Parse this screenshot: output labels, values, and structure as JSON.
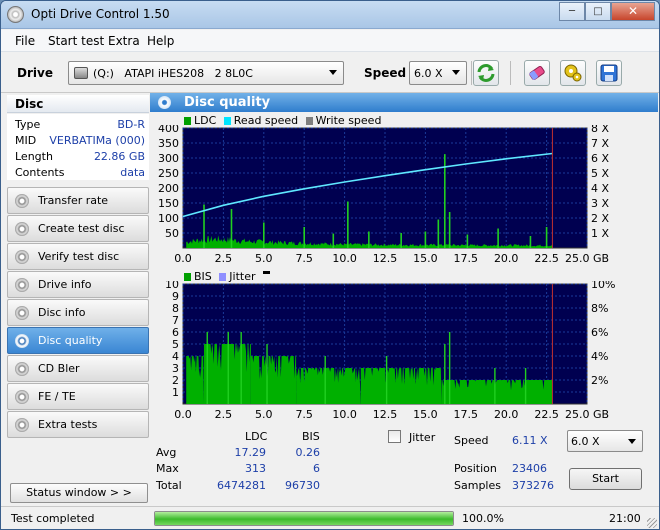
{
  "app": {
    "title": "Opti Drive Control 1.50"
  },
  "window_buttons": {
    "minimize": "─",
    "maximize": "□",
    "close": "✕"
  },
  "menu": [
    "File",
    "Start test",
    "Extra",
    "Help"
  ],
  "toolbar": {
    "drive_label": "Drive",
    "drive_value": "(Q:)   ATAPI iHES208   2 8L0C",
    "speed_label": "Speed",
    "speed_value": "6.0 X",
    "buttons": [
      "refresh-icon",
      "eraser-icon",
      "settings-icon",
      "save-icon"
    ]
  },
  "disc": {
    "header": "Disc",
    "info": [
      {
        "key": "Type",
        "value": "BD-R"
      },
      {
        "key": "MID",
        "value": "VERBATIMa (000)"
      },
      {
        "key": "Length",
        "value": "22.86 GB"
      },
      {
        "key": "Contents",
        "value": "data"
      }
    ]
  },
  "nav": [
    {
      "label": "Transfer rate",
      "active": false
    },
    {
      "label": "Create test disc",
      "active": false
    },
    {
      "label": "Verify test disc",
      "active": false
    },
    {
      "label": "Drive info",
      "active": false
    },
    {
      "label": "Disc info",
      "active": false
    },
    {
      "label": "Disc quality",
      "active": true
    },
    {
      "label": "CD Bler",
      "active": false
    },
    {
      "label": "FE / TE",
      "active": false
    },
    {
      "label": "Extra tests",
      "active": false
    }
  ],
  "status_window_button": "Status window > >",
  "panel": {
    "title": "Disc quality"
  },
  "chart_data": [
    {
      "type": "area",
      "legend": [
        {
          "name": "LDC",
          "color": "#00a000"
        },
        {
          "name": "Read speed",
          "color": "#00e5ff"
        },
        {
          "name": "Write speed",
          "color": "#7f7f7f"
        }
      ],
      "x_ticks": [
        "0.0",
        "2.5",
        "5.0",
        "7.5",
        "10.0",
        "12.5",
        "15.0",
        "17.5",
        "20.0",
        "22.5",
        "25.0 GB"
      ],
      "xlim": [
        0,
        25
      ],
      "y_ticks": [
        "400",
        "350",
        "300",
        "250",
        "200",
        "150",
        "100",
        "50"
      ],
      "ylim": [
        0,
        400
      ],
      "y2_ticks": [
        "8 X",
        "7 X",
        "6 X",
        "5 X",
        "4 X",
        "3 X",
        "2 X",
        "1 X"
      ],
      "y2lim": [
        0,
        8
      ],
      "disc_end": 22.86,
      "series": [
        {
          "name": "LDC",
          "baseline": [
            [
              0.2,
              20
            ],
            [
              1,
              26
            ],
            [
              2,
              30
            ],
            [
              3,
              26
            ],
            [
              4,
              22
            ],
            [
              6,
              18
            ],
            [
              8,
              15
            ],
            [
              10,
              12
            ],
            [
              12,
              11
            ],
            [
              14,
              10
            ],
            [
              16,
              10
            ],
            [
              18,
              9
            ],
            [
              20,
              9
            ],
            [
              22.8,
              8
            ]
          ]
        },
        {
          "name": "LDC spikes",
          "points": [
            [
              1.3,
              145
            ],
            [
              3.0,
              130
            ],
            [
              5.0,
              85
            ],
            [
              7.5,
              70
            ],
            [
              9.3,
              48
            ],
            [
              10.2,
              155
            ],
            [
              11.5,
              55
            ],
            [
              13.5,
              50
            ],
            [
              15.0,
              55
            ],
            [
              15.8,
              95
            ],
            [
              16.2,
              313
            ],
            [
              16.5,
              120
            ],
            [
              17.6,
              45
            ],
            [
              19.5,
              65
            ],
            [
              21.5,
              40
            ],
            [
              22.5,
              70
            ]
          ]
        },
        {
          "name": "Read speed",
          "points": [
            [
              0,
              2.1
            ],
            [
              2.5,
              2.85
            ],
            [
              5.0,
              3.45
            ],
            [
              7.5,
              3.95
            ],
            [
              10.0,
              4.4
            ],
            [
              12.5,
              4.82
            ],
            [
              15.0,
              5.22
            ],
            [
              17.5,
              5.6
            ],
            [
              20.0,
              5.95
            ],
            [
              22.86,
              6.3
            ]
          ]
        }
      ]
    },
    {
      "type": "area",
      "legend": [
        {
          "name": "BIS",
          "color": "#00a000"
        },
        {
          "name": "Jitter",
          "color": "#8f8fff"
        }
      ],
      "x_ticks": [
        "0.0",
        "2.5",
        "5.0",
        "7.5",
        "10.0",
        "12.5",
        "15.0",
        "17.5",
        "20.0",
        "22.5",
        "25.0 GB"
      ],
      "xlim": [
        0,
        25
      ],
      "y_ticks": [
        "10",
        "9",
        "8",
        "7",
        "6",
        "5",
        "4",
        "3",
        "2",
        "1"
      ],
      "ylim": [
        0,
        10
      ],
      "y2_ticks": [
        "10%",
        "8%",
        "6%",
        "4%",
        "2%"
      ],
      "y2lim": [
        0,
        10
      ],
      "disc_end": 22.86,
      "series": [
        {
          "name": "BIS",
          "bands": [
            [
              0.2,
              1.3,
              4
            ],
            [
              1.3,
              4.2,
              5
            ],
            [
              4.2,
              7.0,
              4
            ],
            [
              7.0,
              11.0,
              3
            ],
            [
              11.0,
              16.0,
              3
            ],
            [
              16.0,
              22.86,
              2
            ]
          ]
        },
        {
          "name": "BIS spikes",
          "points": [
            [
              1.5,
              6
            ],
            [
              2.8,
              6
            ],
            [
              3.6,
              6
            ],
            [
              5.2,
              5
            ],
            [
              8.8,
              4
            ],
            [
              12.6,
              4
            ],
            [
              16.2,
              5
            ],
            [
              16.5,
              6
            ],
            [
              19.3,
              3
            ],
            [
              21.2,
              3
            ]
          ]
        }
      ]
    }
  ],
  "stats": {
    "col_ldc": "LDC",
    "col_bis": "BIS",
    "rows": [
      {
        "label": "Avg",
        "ldc": "17.29",
        "bis": "0.26"
      },
      {
        "label": "Max",
        "ldc": "313",
        "bis": "6"
      },
      {
        "label": "Total",
        "ldc": "6474281",
        "bis": "96730"
      }
    ],
    "jitter_label": "Jitter",
    "speed_label": "Speed",
    "speed_value": "6.11 X",
    "speed_select": "6.0 X",
    "position_label": "Position",
    "position_value": "23406",
    "samples_label": "Samples",
    "samples_value": "373276",
    "start_button": "Start"
  },
  "statusbar": {
    "text": "Test completed",
    "progress": 100,
    "progress_text": "100.0%",
    "time": "21:00"
  }
}
